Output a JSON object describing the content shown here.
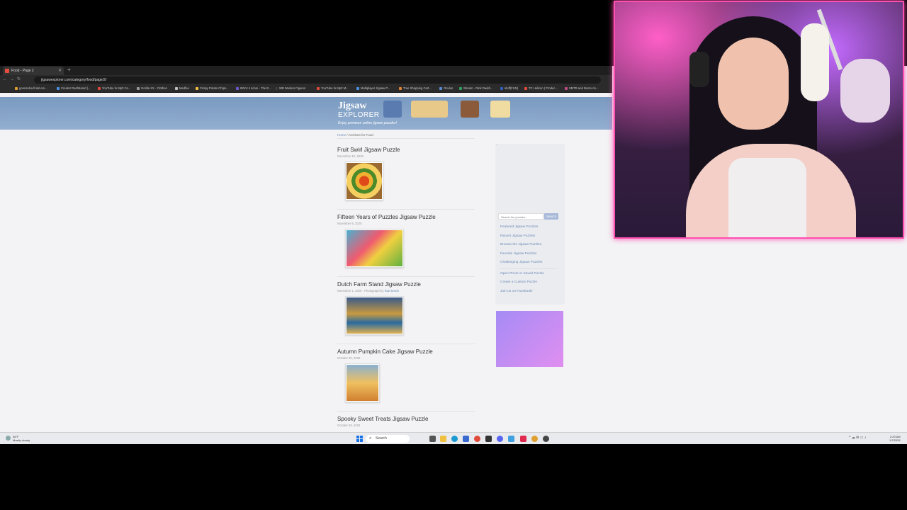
{
  "browser": {
    "tab_title": "Food - Page 2",
    "new_tab": "+",
    "url": "jigsawexplorer.com/category/food/page/2/",
    "bookmarks": [
      "goonsolva fintel em...",
      "Creator Dashboard |...",
      "YouTube to Mp3 Co...",
      "Gorilla XX - Clothes",
      "Medfee",
      "Crispy Potato Chips...",
      "IMVU 4 score - The E...",
      "WB Westen Figures",
      "YouTube to Mp3 M...",
      "Multiplayer Jigsaw P...",
      "True Shopping Cart...",
      "Oculus",
      "Stream - Rink Daddi...",
      "stuff(FUN)",
      "TC Helicon | Produc...",
      "SMTB and Boom An..."
    ]
  },
  "site": {
    "logo_line1": "Jigsaw",
    "logo_line2": "EXPLORER",
    "tagline": "Enjoy premium online jigsaw puzzles!",
    "breadcrumb_home": "Home",
    "breadcrumb_rest": " / Archives for Food"
  },
  "posts": [
    {
      "title": "Fruit Swirl Jigsaw Puzzle",
      "date": "November 10, 2025",
      "credit": "",
      "credit_link": ""
    },
    {
      "title": "Fifteen Years of Puzzles Jigsaw Puzzle",
      "date": "November 6, 2025",
      "credit": "",
      "credit_link": ""
    },
    {
      "title": "Dutch Farm Stand Jigsaw Puzzle",
      "date": "November 1, 2025",
      "credit": " · Photograph by ",
      "credit_link": "Rae Bosch"
    },
    {
      "title": "Autumn Pumpkin Cake Jigsaw Puzzle",
      "date": "October 30, 2025",
      "credit": "",
      "credit_link": ""
    },
    {
      "title": "Spooky Sweet Treats Jigsaw Puzzle",
      "date": "October 29, 2025",
      "credit": "",
      "credit_link": ""
    }
  ],
  "sidebar": {
    "search_placeholder": "Search the puzzles...",
    "search_button": "Search",
    "links": [
      "Featured Jigsaw Puzzles",
      "Recent Jigsaw Puzzles",
      "Browse the Jigsaw Puzzles",
      "Favorite Jigsaw Puzzles",
      "Challenging Jigsaw Puzzles"
    ],
    "links2": [
      "Open Photo or Saved Puzzle",
      "Create a Custom Puzzle",
      "Join us on Facebook!"
    ]
  },
  "taskbar": {
    "weather_temp": "36°F",
    "weather_desc": "Mostly cloudy",
    "search_label": "Search",
    "time": "2:29 AM",
    "date": "1/7/2026"
  },
  "colors": {
    "webcam_border": "#ff4fb0",
    "ad_gradient_start": "#a58cf5",
    "ad_gradient_end": "#e08ef0",
    "link": "#6a8ab8"
  }
}
